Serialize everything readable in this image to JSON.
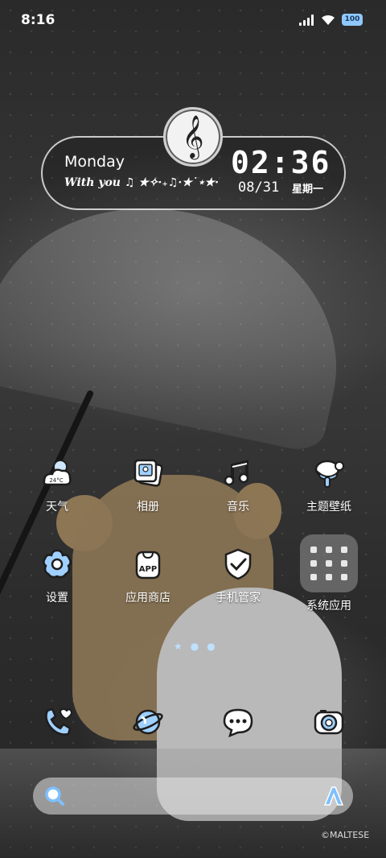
{
  "status_bar": {
    "time": "8:16",
    "battery": "100"
  },
  "widget": {
    "day": "Monday",
    "with_text": "With you ♫ ★✧·₊♫·★˙⋆★·",
    "clock": "02:36",
    "date": "08/31",
    "weekday": "星期一",
    "clef_icon": "treble-clef-icon"
  },
  "apps_row1": [
    {
      "label": "天气",
      "icon": "weather-icon",
      "temp": "24°C"
    },
    {
      "label": "相册",
      "icon": "gallery-icon"
    },
    {
      "label": "音乐",
      "icon": "music-icon"
    },
    {
      "label": "主题壁纸",
      "icon": "theme-icon"
    }
  ],
  "apps_row2": [
    {
      "label": "设置",
      "icon": "settings-icon"
    },
    {
      "label": "应用商店",
      "icon": "app-store-icon",
      "badge": "APP"
    },
    {
      "label": "手机管家",
      "icon": "security-icon"
    },
    {
      "label": "系统应用",
      "icon": "system-folder-icon"
    }
  ],
  "dock": [
    "phone-icon",
    "browser-icon",
    "messages-icon",
    "camera-icon"
  ],
  "copyright": "©MALTESE",
  "colors": {
    "accent": "#8fc8ff",
    "icon_outline": "#1d1d1d"
  }
}
